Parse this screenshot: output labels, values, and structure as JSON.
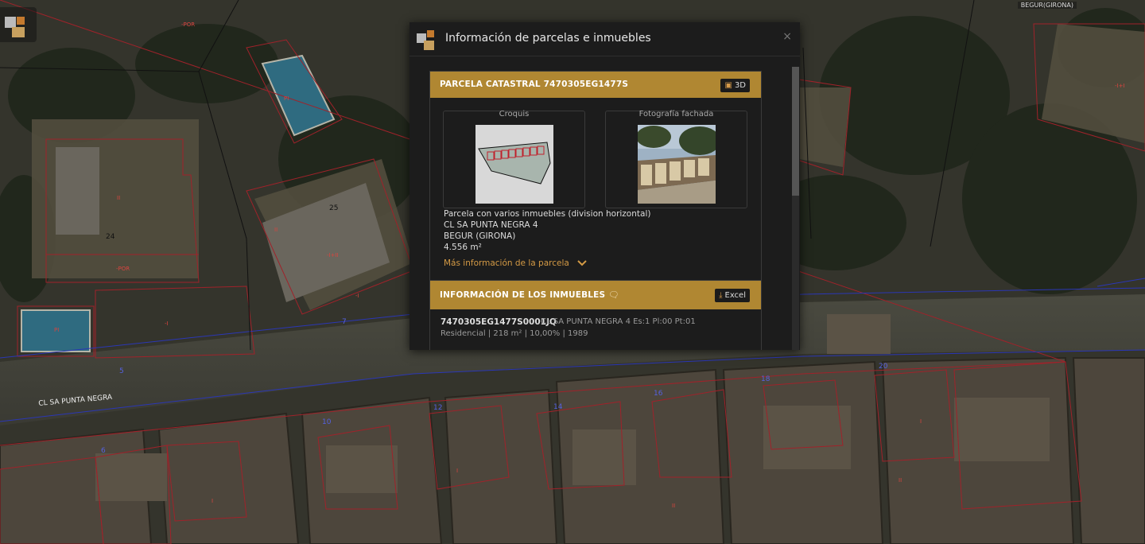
{
  "map": {
    "street_name": "CL SA PUNTA NEGRA",
    "crs_badge": "BEGUR(GIRONA)",
    "labels": {
      "n24": "24",
      "n25": "25",
      "n5": "5",
      "n7": "7",
      "n6": "6",
      "n10": "10",
      "n12": "12",
      "n14": "14",
      "n16": "16",
      "n18": "18",
      "n20": "20",
      "por1": "-POR",
      "por2": "-POR",
      "pi1": "PI",
      "pi2": "PI",
      "ii1": "II",
      "ii2": "II",
      "ii3": "II",
      "ii4": "II",
      "i1": "-I",
      "i2": "-I",
      "i3": "I",
      "i4": "I",
      "i5": "I",
      "iii": "-I+II",
      "ih": "-I+I"
    }
  },
  "dialog": {
    "title": "Información de parcelas e inmuebles",
    "close": "×",
    "parcel": {
      "title": "PARCELA CATASTRAL 7470305EG1477S",
      "btn_3d": "3D",
      "sketch_title": "Croquis",
      "photo_title": "Fotografía fachada",
      "description": "Parcela con varios inmuebles (division horizontal)",
      "address": "CL SA PUNTA NEGRA 4",
      "municipality": "BEGUR (GIRONA)",
      "area": "4.556 m²",
      "more_info": "Más información de la parcela"
    },
    "properties": {
      "title": "INFORMACIÓN DE LOS INMUEBLES",
      "btn_excel": "Excel",
      "items": [
        {
          "ref": "7470305EG1477S0001JQ",
          "address": "CL SA PUNTA NEGRA 4 Es:1 Pl:00 Pt:01",
          "meta": "Residencial | 218 m² | 10,00% | 1989"
        }
      ]
    }
  },
  "colors": {
    "accent": "#b08732",
    "link": "#d49a45",
    "parcel_line": "#a0222a",
    "street_line": "#2b37b5"
  }
}
